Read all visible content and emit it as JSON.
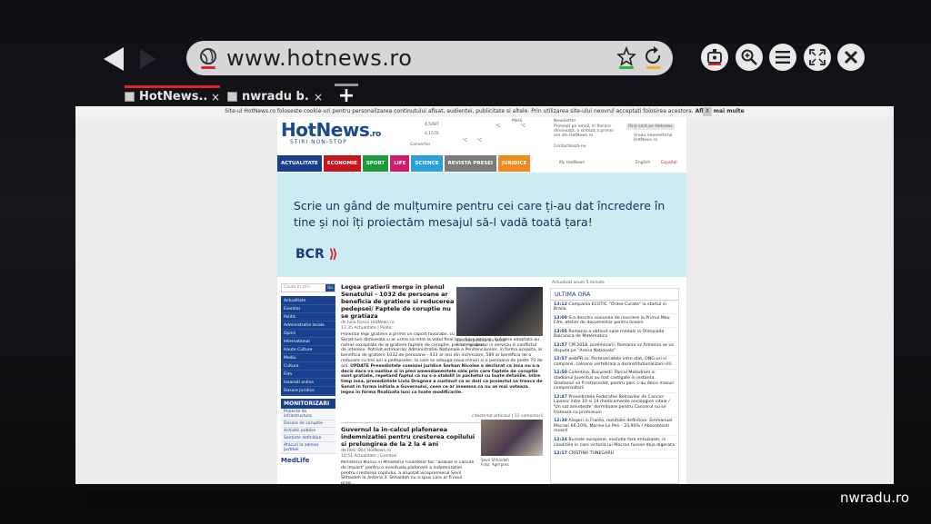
{
  "browser": {
    "url": "www.hotnews.ro",
    "tabs": [
      {
        "title": "HotNews....",
        "close": "×"
      },
      {
        "title": "nwradu b...",
        "close": "×"
      }
    ],
    "new_tab_label": "+",
    "icons": [
      "back-arrow-icon",
      "forward-arrow-icon",
      "globe-icon",
      "star-add-icon",
      "reload-icon",
      "screen-remote-icon",
      "zoom-icon",
      "menu-icon",
      "fullscreen-icon",
      "close-icon"
    ],
    "colors": {
      "active_tab": "#e0202a",
      "urlbar": "#d6d6d9"
    }
  },
  "page": {
    "cookie_notice": "Site-ul HotNews.ro foloseste cookie-uri pentru personalizarea continutului afisat, audientei, publicitate si altele. Prin utilizarea site-ului neovrul acceptati folosirea acestora.",
    "cookie_more": "Aflati mai multe",
    "cookie_close": "X",
    "logo": {
      "hot": "HotNews",
      "ro": ".ro",
      "tagline": "STIRI NON-STOP"
    },
    "rates": [
      "4,5487",
      "4,1576"
    ],
    "convertor": "Convertor",
    "weather": [
      "Marti",
      "°C",
      "°C",
      "°C",
      "°C"
    ],
    "newsletter": {
      "label": "Newsletter",
      "text": "Primeşti pe email, în fiecare dimineaţă, o sinteză a primei ore din HotNews.ro",
      "contact": "Contactează-ne",
      "subscribe_btn": "Fă-ţi cont pe Hotnews",
      "view": "Vreau newsletterul HotNews.ro"
    },
    "menu": [
      {
        "label": "ACTUALITATE",
        "color": "#1a3f8c"
      },
      {
        "label": "ECONOMIE",
        "color": "#c8161d"
      },
      {
        "label": "SPORT",
        "color": "#1d9a3c"
      },
      {
        "label": "LIFE",
        "color": "#d21a6e"
      },
      {
        "label": "SCIENCE",
        "color": "#2aa0d8"
      },
      {
        "label": "REVISTA PRESEI",
        "color": "#7a7a7a"
      },
      {
        "label": "JURIDICE",
        "color": "#f08a1c"
      }
    ],
    "my_hotnews": "My HotNews",
    "lang": [
      "English",
      "Español"
    ],
    "banner": {
      "text": "Scrie un gând de mulțumire pentru cei care ți-au dat încredere în tine și noi îți proiectăm mesajul să-l vadă toată țara!",
      "brand": "BCR",
      "brand_mark": "⟫"
    },
    "search_placeholder": "Caută în ştiri",
    "search_go": "Go",
    "sidebar": [
      "Actualitate",
      "Esential",
      "Politic",
      "Administratie locala",
      "Opinii",
      "International",
      "Haute Culture",
      "Mediu",
      "Cultura",
      "Film",
      "Insanati online",
      "Dosare Juridice"
    ],
    "monitorizari": {
      "title": "MONITORIZARI",
      "items": [
        "Proiecte de infrastructura",
        "Dosare de coruptie",
        "Achizitii publice",
        "Sentinte definitive",
        "Atacuri la adresa justitiei"
      ]
    },
    "medlife": "MedLife",
    "article1": {
      "headline": "Legea gratierii merge in plenul Senatului - 1032 de persoane ar beneficia de gratiere si reducerea pedepsei/ Faptele de coruptie nu se gratiaza",
      "byline": "de Iulia Rosca HotNews.ro",
      "meta": "11:35 Actualitate | Politic",
      "body": "Proiectul legii gratierii a primit un raport favorabil, cu amendamente, in comisia juridica din Senat luni dimineata si ar urma sa intre la votul final luni dupa-amiaza. In forma adoptata au ramas exceptate de la gratiere faptele de coruptie, precum si abuzul in serviciu si conflictul de interese. Potrivit estimarilor Administratiei Nationale a Penitenciarelor, in forma aceasta, ar beneficia de gratiere 1032 de persoane - 433 ar iesi din inchisoare, 589 ar beneficia de o reducere cu trei ani a pedepselor, la care se adauga noua minori si o persoana de peste 70 de ani.",
      "update": "UPDATE Presedintele comisiei juridice Serban Nicolae a declarat ca inca nu s-a decis daca va sustine si in plen amendamentele sale prin care faptele de coruptie sunt gratiate, repetand faptul ca nu s-a stabilit in pachetul cu toate detaliile. Intre timp insa, presedintele Liviu Dragnea a sustinut ca ar dori ca proiectul sa treaca de Senat in forma initiala a Guvernului, ceea ce ar insemna ca nu se mai voteaza legea in forma finalizata luni ca toate modificarile.",
      "caption": "Comisia Juridica din Senat",
      "photo_credit": "Foto: Agerpres",
      "more": "citeste tot articolul",
      "comments": "12 comentarii"
    },
    "article2": {
      "headline": "Guvernul la in-calcul plafonarea indemnizatiei pentru cresterea copilului si prelungirea de la 2 la 4 ani",
      "byline": "de Red. Stiri HotNews.ro",
      "meta": "10:51 Actualitate | Esential",
      "body": "Ministerul Muncii si Ministerul Finantelor fac \"analize si calcule de impact\" pentru o eventuala plafonare a indemnizatiei pentru cresterea copilului, a anuntat vicepremierul Sevil Shhaideh la Antena 3. Shhaideh nu a spus care ar fi noul prag...",
      "caption": "Sevil Shhaideh",
      "photo_credit": "Foto: Agerpres"
    },
    "updated": "Actualizat acum 5 minute",
    "ultima_ora": {
      "title": "ULTIMA ORA",
      "items": [
        {
          "time": "13:12",
          "text": "Campania ECOTIC \"Orase Curate\" la startul in Braila"
        },
        {
          "time": "13:09",
          "text": "S-a deschis sesiunea de inscriere la Primul Meu Film, atelier de documentar pentru liceeni"
        },
        {
          "time": "13:05",
          "text": "Romania a obtinut sase medalii la Olimpiada Balcanica de Matematica"
        },
        {
          "time": "12:57",
          "text": "CM 2018, preliminarii: Romania vs Armenia se va disputa pe \"Arena Nationala\""
        },
        {
          "time": "12:57",
          "text": "webPR.ro: Parteneriatele intre stat, ONG-uri si companii, coloana vertebrala a dezinstitutionalizarii (II)"
        },
        {
          "time": "12:50",
          "text": "Colentina, Bucuresti: Parcul Motodrom si stadionul Juventus au fost castigate in instanta. Stadionul va fi retrocedat, pentru parc s-au decis masuri compensatorii"
        },
        {
          "time": "12:47",
          "text": "Presedintele Federatiei Bolnavilor de Cancer: Lipsesc intre 10 si 14 medicamente oncologice vitale / 'Un sat aminteste' dormitoare pentru Cancerul nu se trateaza cu promisiuni"
        },
        {
          "time": "12:30",
          "text": "Alegeri in Franta, rezultate definitive: Emmanuel Macron 66,10%, Marine Le Pen - 33,90% / Absenteism record"
        },
        {
          "time": "12:24",
          "text": "Bursele europene, evolutie fara entuziasm, in conditiile in care victoria lui Macron fusese deja digerata"
        },
        {
          "time": "12:17",
          "text": "CRISTINA TUNEGARU"
        }
      ]
    }
  },
  "watermark": "nwradu.ro"
}
